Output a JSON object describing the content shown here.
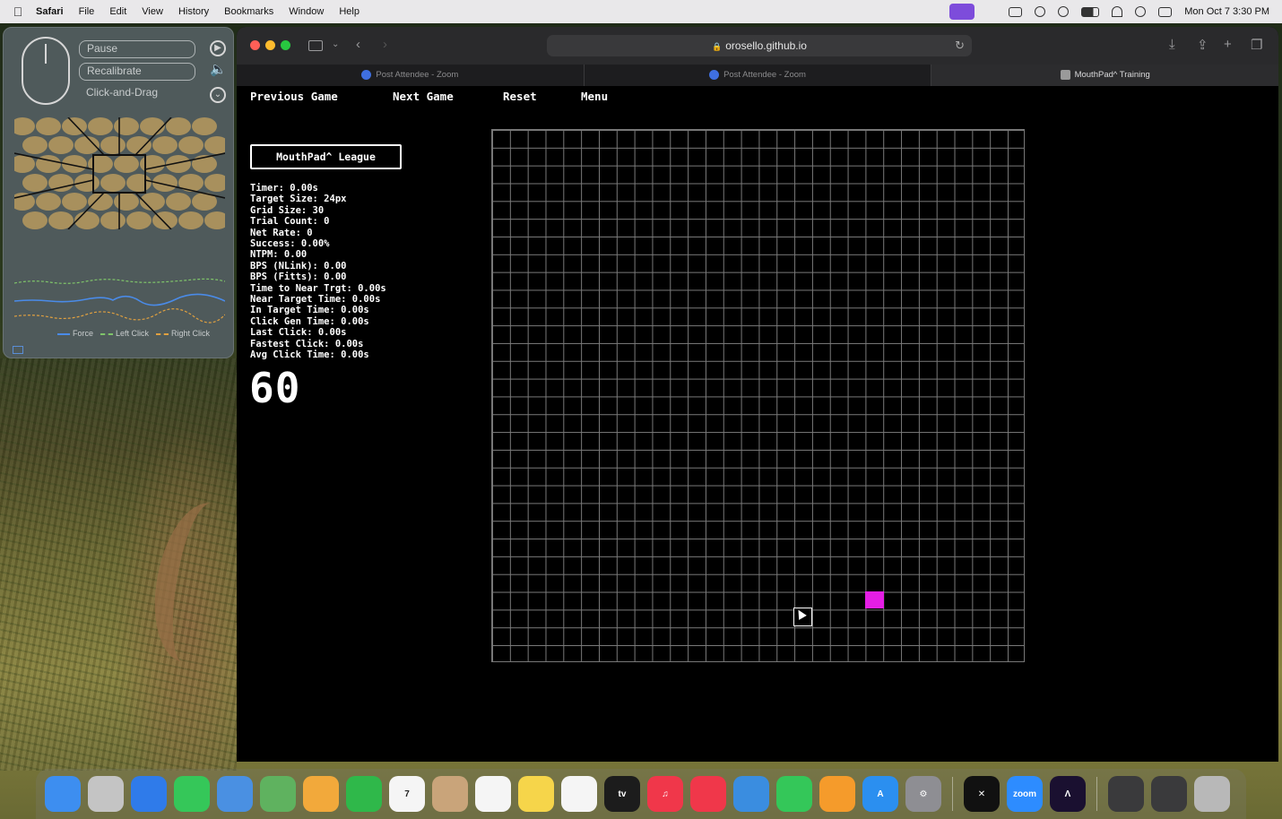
{
  "menubar": {
    "app_name": "Safari",
    "items": [
      "File",
      "Edit",
      "View",
      "History",
      "Bookmarks",
      "Window",
      "Help"
    ],
    "clock": "Mon Oct 7  3:30 PM",
    "status_icons": [
      "screen-share-icon",
      "screen-mirror-icon",
      "user-icon",
      "play-icon",
      "battery-icon",
      "wifi-icon",
      "search-icon",
      "control-center-icon"
    ]
  },
  "mouthpad": {
    "pause_label": "Pause",
    "recalibrate_label": "Recalibrate",
    "drag_label": "Click-and-Drag",
    "legend": {
      "force": "Force",
      "left_click": "Left Click",
      "right_click": "Right Click"
    },
    "colors": {
      "force": "#4a8be8",
      "left_click": "#7fc46a",
      "right_click": "#e0a040",
      "sensor_pad": "#b79a5e"
    }
  },
  "browser": {
    "url": "orosello.github.io",
    "tabs": [
      {
        "label": "Post Attendee - Zoom",
        "active": false
      },
      {
        "label": "Post Attendee - Zoom",
        "active": false
      },
      {
        "label": "MouthPad^ Training",
        "active": true
      }
    ]
  },
  "page": {
    "nav": {
      "previous": "Previous Game",
      "next": "Next Game",
      "reset": "Reset",
      "menu": "Menu"
    },
    "league_label": "MouthPad^ League",
    "stats": [
      "Timer: 0.00s",
      "Target Size: 24px",
      "Grid Size: 30",
      "Trial Count: 0",
      "Net Rate: 0",
      "Success: 0.00%",
      "NTPM: 0.00",
      "BPS (NLink): 0.00",
      "BPS (Fitts): 0.00",
      "Time to Near Trgt: 0.00s",
      "Near Target Time: 0.00s",
      "In Target Time: 0.00s",
      "Click Gen Time: 0.00s",
      "Last Click: 0.00s",
      "Fastest Click: 0.00s",
      "Avg Click Time: 0.00s"
    ],
    "countdown": "60",
    "target_color": "#e41ee4"
  },
  "dock": {
    "apps": [
      {
        "name": "finder-icon",
        "color": "#3d8ef0",
        "text": ""
      },
      {
        "name": "launchpad-icon",
        "color": "#c4c4c4",
        "text": ""
      },
      {
        "name": "safari-icon",
        "color": "#2f7bea",
        "text": ""
      },
      {
        "name": "messages-icon",
        "color": "#35c759",
        "text": ""
      },
      {
        "name": "mail-icon",
        "color": "#4a90e2",
        "text": ""
      },
      {
        "name": "maps-icon",
        "color": "#5fb25f",
        "text": ""
      },
      {
        "name": "photos-icon",
        "color": "#f2a93b",
        "text": ""
      },
      {
        "name": "facetime-icon",
        "color": "#2fb84a",
        "text": ""
      },
      {
        "name": "calendar-icon",
        "color": "#f5f5f5",
        "text": "7"
      },
      {
        "name": "contacts-icon",
        "color": "#c9a47a",
        "text": ""
      },
      {
        "name": "reminders-icon",
        "color": "#f5f5f5",
        "text": ""
      },
      {
        "name": "notes-icon",
        "color": "#f6d54a",
        "text": ""
      },
      {
        "name": "freeform-icon",
        "color": "#f5f5f5",
        "text": ""
      },
      {
        "name": "apple-tv-icon",
        "color": "#1c1c1c",
        "text": "tv"
      },
      {
        "name": "music-icon",
        "color": "#f0374a",
        "text": "♫"
      },
      {
        "name": "news-icon",
        "color": "#f0374a",
        "text": ""
      },
      {
        "name": "keynote-icon",
        "color": "#3a8de0",
        "text": ""
      },
      {
        "name": "numbers-icon",
        "color": "#34c759",
        "text": ""
      },
      {
        "name": "pages-icon",
        "color": "#f59b2b",
        "text": ""
      },
      {
        "name": "app-store-icon",
        "color": "#2b8ff0",
        "text": "A"
      },
      {
        "name": "system-settings-icon",
        "color": "#8e8e93",
        "text": "⚙"
      },
      {
        "name": "capcut-icon",
        "color": "#111111",
        "text": "✕"
      },
      {
        "name": "zoom-icon",
        "color": "#2d8cff",
        "text": "zoom"
      },
      {
        "name": "mouthpad-app-icon",
        "color": "#1a1030",
        "text": "Λ"
      },
      {
        "name": "window-thumbnail-icon",
        "color": "#3a3a3c",
        "text": ""
      },
      {
        "name": "window-thumbnail-icon",
        "color": "#3a3a3c",
        "text": ""
      },
      {
        "name": "trash-icon",
        "color": "#b8b8b8",
        "text": ""
      }
    ]
  }
}
